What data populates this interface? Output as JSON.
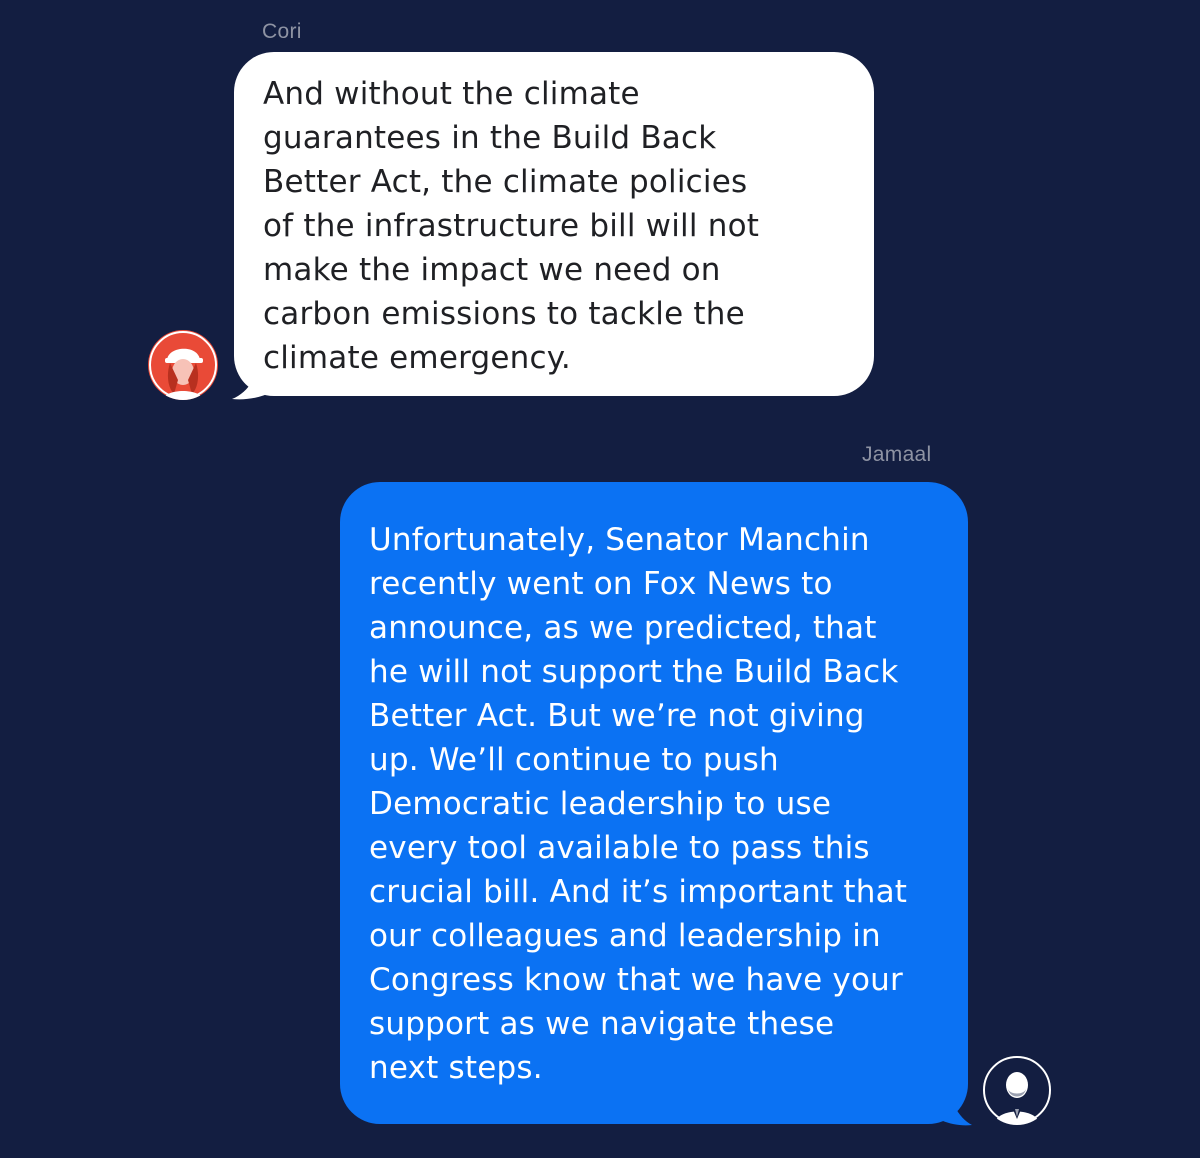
{
  "conversation": {
    "messages": [
      {
        "sender": "Cori",
        "direction": "incoming",
        "text": "And without the climate\nguarantees in the Build Back\nBetter Act, the climate policies\nof the infrastructure bill will not\nmake the impact we need on\ncarbon emissions to tackle the\nclimate emergency."
      },
      {
        "sender": "Jamaal",
        "direction": "outgoing",
        "text": "Unfortunately, Senator Manchin\nrecently went on Fox News to\nannounce, as we predicted, that\nhe will not support the Build Back\nBetter Act. But we’re not giving\nup. We’ll continue to push\nDemocratic leadership to use\nevery tool available to pass this\ncrucial bill. And it’s important that\nour colleagues and leadership in\nCongress know that we have your\nsupport as we navigate these\nnext steps."
      }
    ]
  },
  "colors": {
    "background": "#131e41",
    "incoming_bubble": "#ffffff",
    "outgoing_bubble": "#0b72f3",
    "sender_name": "#8e93a3",
    "avatar_cori": "#e94a37",
    "avatar_jamaal": "#131e41"
  }
}
